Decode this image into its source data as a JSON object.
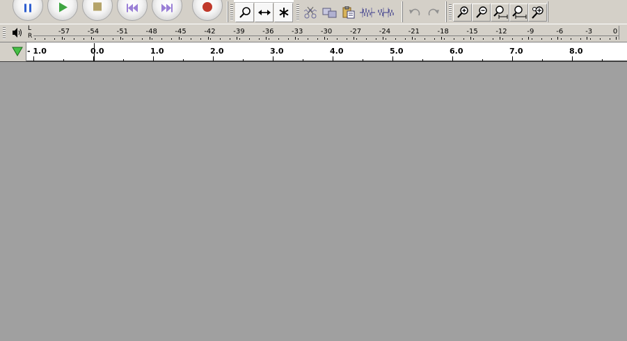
{
  "transport": {
    "buttons": [
      {
        "name": "pause-button",
        "icon": "pause-icon",
        "color": "#2f5fd0"
      },
      {
        "name": "play-button",
        "icon": "play-icon",
        "color": "#3fa542"
      },
      {
        "name": "stop-button",
        "icon": "stop-icon",
        "color": "#b5a46a"
      },
      {
        "name": "skip-to-start-button",
        "icon": "skip-start-icon",
        "color": "#9a7fd6"
      },
      {
        "name": "skip-to-end-button",
        "icon": "skip-end-icon",
        "color": "#9a7fd6"
      },
      {
        "name": "record-button",
        "icon": "record-icon",
        "color": "#c0392b"
      }
    ]
  },
  "tools": {
    "items": [
      {
        "name": "zoom-tool-button",
        "icon": "magnifier-icon"
      },
      {
        "name": "timeshift-tool-button",
        "icon": "double-arrow-icon"
      },
      {
        "name": "multi-tool-button",
        "icon": "asterisk-icon"
      }
    ]
  },
  "edit": {
    "items": [
      {
        "name": "cut-button",
        "icon": "scissors-icon"
      },
      {
        "name": "copy-button",
        "icon": "copy-icon"
      },
      {
        "name": "paste-button",
        "icon": "paste-icon"
      },
      {
        "name": "trim-button",
        "icon": "trim-icon"
      },
      {
        "name": "silence-button",
        "icon": "silence-icon"
      },
      {
        "name": "undo-button",
        "icon": "undo-icon"
      },
      {
        "name": "redo-button",
        "icon": "redo-icon"
      }
    ]
  },
  "zoom": {
    "items": [
      {
        "name": "zoom-in-button",
        "icon": "zoom-in-icon"
      },
      {
        "name": "zoom-out-button",
        "icon": "zoom-out-icon"
      },
      {
        "name": "fit-selection-button",
        "icon": "zoom-selection-icon"
      },
      {
        "name": "fit-project-button",
        "icon": "zoom-fit-icon"
      },
      {
        "name": "zoom-toggle-button",
        "icon": "zoom-toggle-icon"
      }
    ]
  },
  "meter": {
    "channel_left": "L",
    "channel_right": "R",
    "icon": "speaker-icon",
    "db_labels": [
      "-57",
      "-54",
      "-51",
      "-48",
      "-45",
      "-42",
      "-39",
      "-36",
      "-33",
      "-30",
      "-27",
      "-24",
      "-21",
      "-18",
      "-15",
      "-12",
      "-9",
      "-6",
      "-3",
      "0"
    ]
  },
  "timeline": {
    "icon": "play-triangle-icon",
    "labels": [
      "- 1.0",
      "0.0",
      "1.0",
      "2.0",
      "3.0",
      "4.0",
      "5.0",
      "6.0",
      "7.0",
      "8.0"
    ],
    "playhead_seconds": 0.0
  }
}
